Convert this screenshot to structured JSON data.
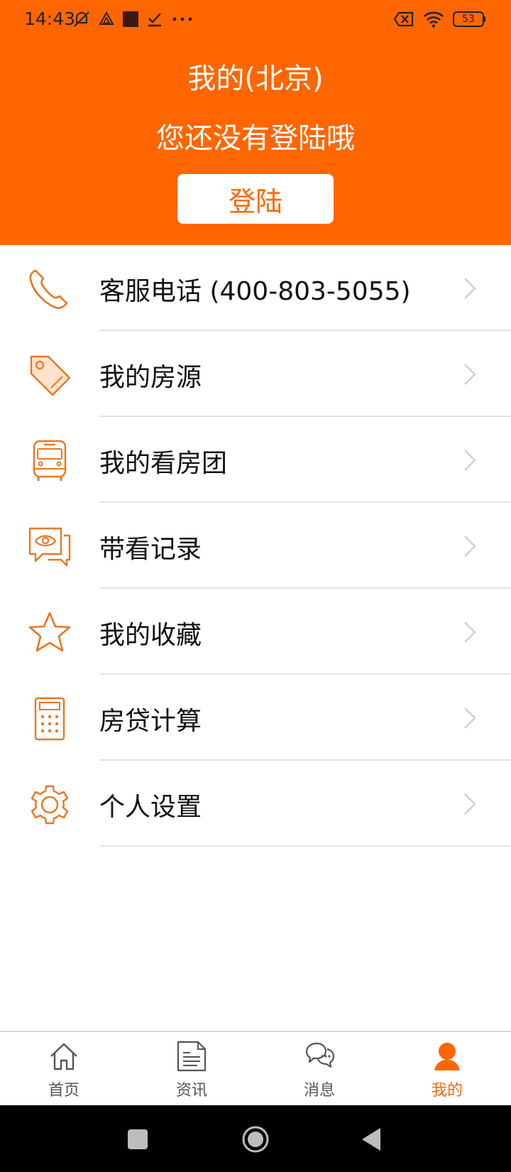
{
  "status_bar": {
    "time": "14:43",
    "battery": "53"
  },
  "header": {
    "title": "我的(北京)",
    "subtitle": "您还没有登陆哦",
    "login_label": "登陆"
  },
  "menu": {
    "items": [
      {
        "label": "客服电话  (400-803-5055)",
        "icon": "phone-icon"
      },
      {
        "label": "我的房源",
        "icon": "tag-icon"
      },
      {
        "label": "我的看房团",
        "icon": "bus-icon"
      },
      {
        "label": "带看记录",
        "icon": "eye-chat-icon"
      },
      {
        "label": "我的收藏",
        "icon": "star-icon"
      },
      {
        "label": "房贷计算",
        "icon": "calculator-icon"
      },
      {
        "label": "个人设置",
        "icon": "gear-icon"
      }
    ]
  },
  "tabbar": {
    "tabs": [
      {
        "label": "首页",
        "icon": "home-icon"
      },
      {
        "label": "资讯",
        "icon": "news-icon"
      },
      {
        "label": "消息",
        "icon": "chat-icon"
      },
      {
        "label": "我的",
        "icon": "person-icon"
      }
    ],
    "active_index": 3
  },
  "colors": {
    "accent": "#FF6600",
    "icon_stroke": "#E87722"
  }
}
